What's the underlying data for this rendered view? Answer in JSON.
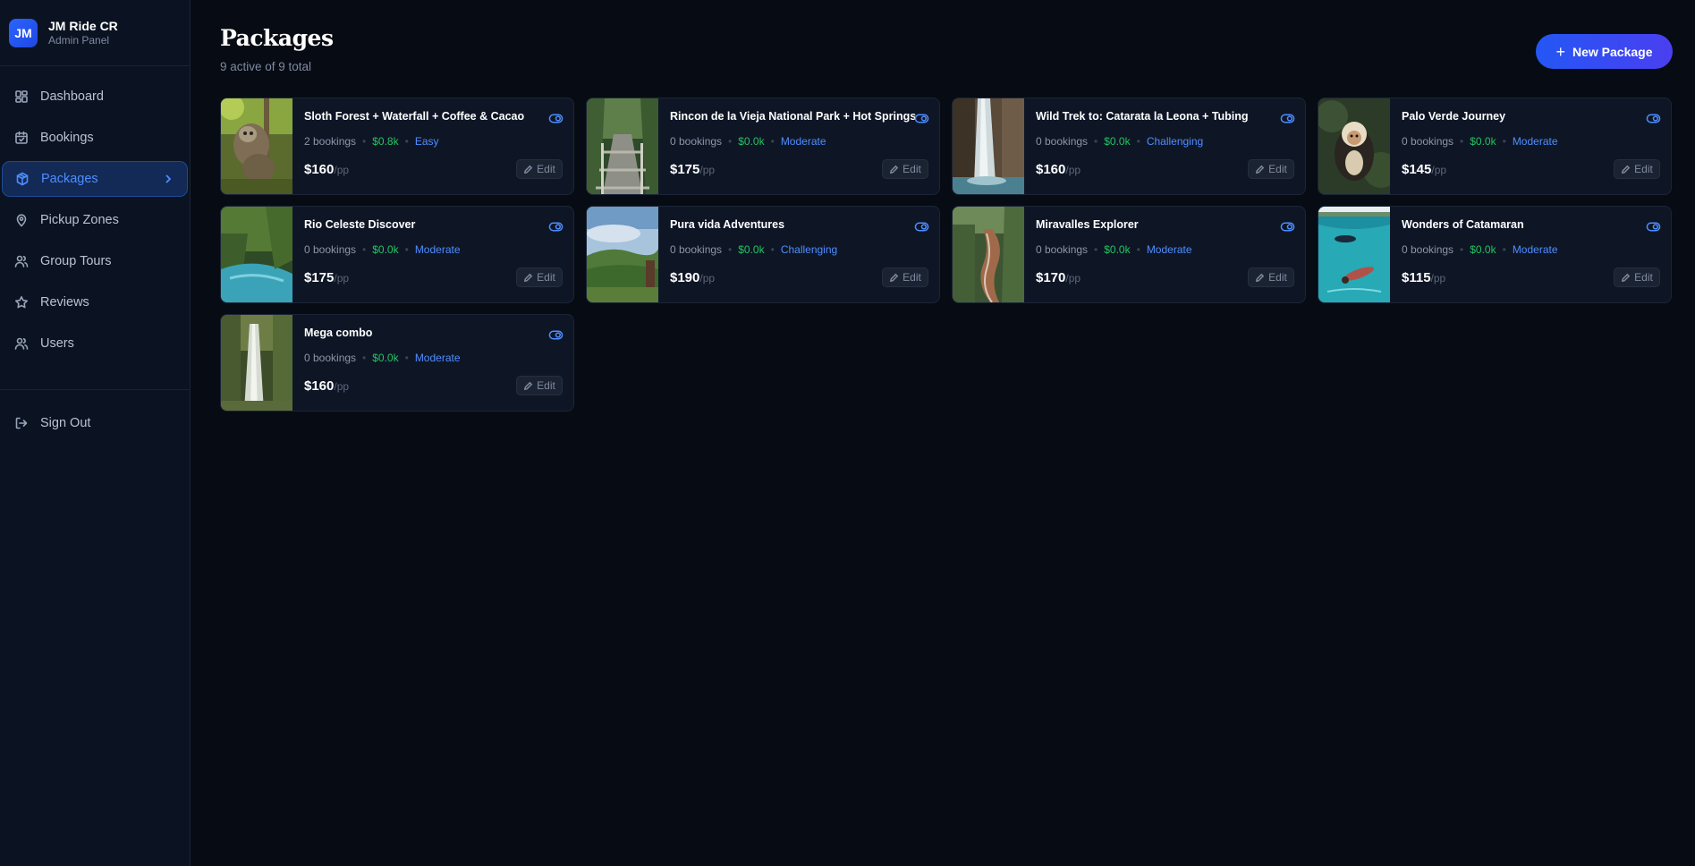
{
  "brand": {
    "logo": "JM",
    "name": "JM Ride CR",
    "subtitle": "Admin Panel"
  },
  "nav": [
    {
      "label": "Dashboard",
      "icon": "dashboard-icon",
      "active": false
    },
    {
      "label": "Bookings",
      "icon": "calendar-icon",
      "active": false
    },
    {
      "label": "Packages",
      "icon": "package-icon",
      "active": true
    },
    {
      "label": "Pickup Zones",
      "icon": "map-pin-icon",
      "active": false
    },
    {
      "label": "Group Tours",
      "icon": "users-icon",
      "active": false
    },
    {
      "label": "Reviews",
      "icon": "star-icon",
      "active": false
    },
    {
      "label": "Users",
      "icon": "users-icon",
      "active": false
    }
  ],
  "signout": {
    "label": "Sign Out",
    "icon": "sign-out-icon"
  },
  "header": {
    "title": "Packages",
    "subtitle": "9 active of 9 total",
    "new_button": "New Package"
  },
  "colors": {
    "accent": "#4f8dff",
    "revenue": "#22c55e",
    "background": "#070b14",
    "card": "#0e1626"
  },
  "packages": [
    {
      "title": "Sloth Forest + Waterfall + Coffee & Cacao",
      "bookings": "2 bookings",
      "revenue": "$0.8k",
      "difficulty": "Easy",
      "price": "$160",
      "per": "/pp",
      "edit": "Edit",
      "visible": true
    },
    {
      "title": "Rincon de la Vieja National Park + Hot Springs",
      "bookings": "0 bookings",
      "revenue": "$0.0k",
      "difficulty": "Moderate",
      "price": "$175",
      "per": "/pp",
      "edit": "Edit",
      "visible": true
    },
    {
      "title": "Wild Trek to: Catarata la Leona + Tubing",
      "bookings": "0 bookings",
      "revenue": "$0.0k",
      "difficulty": "Challenging",
      "price": "$160",
      "per": "/pp",
      "edit": "Edit",
      "visible": true
    },
    {
      "title": "Palo Verde Journey",
      "bookings": "0 bookings",
      "revenue": "$0.0k",
      "difficulty": "Moderate",
      "price": "$145",
      "per": "/pp",
      "edit": "Edit",
      "visible": true
    },
    {
      "title": "Rio Celeste Discover",
      "bookings": "0 bookings",
      "revenue": "$0.0k",
      "difficulty": "Moderate",
      "price": "$175",
      "per": "/pp",
      "edit": "Edit",
      "visible": true
    },
    {
      "title": "Pura vida Adventures",
      "bookings": "0 bookings",
      "revenue": "$0.0k",
      "difficulty": "Challenging",
      "price": "$190",
      "per": "/pp",
      "edit": "Edit",
      "visible": true
    },
    {
      "title": "Miravalles Explorer",
      "bookings": "0 bookings",
      "revenue": "$0.0k",
      "difficulty": "Moderate",
      "price": "$170",
      "per": "/pp",
      "edit": "Edit",
      "visible": true
    },
    {
      "title": "Wonders of Catamaran",
      "bookings": "0 bookings",
      "revenue": "$0.0k",
      "difficulty": "Moderate",
      "price": "$115",
      "per": "/pp",
      "edit": "Edit",
      "visible": true
    },
    {
      "title": "Mega combo",
      "bookings": "0 bookings",
      "revenue": "$0.0k",
      "difficulty": "Moderate",
      "price": "$160",
      "per": "/pp",
      "edit": "Edit",
      "visible": true
    }
  ]
}
